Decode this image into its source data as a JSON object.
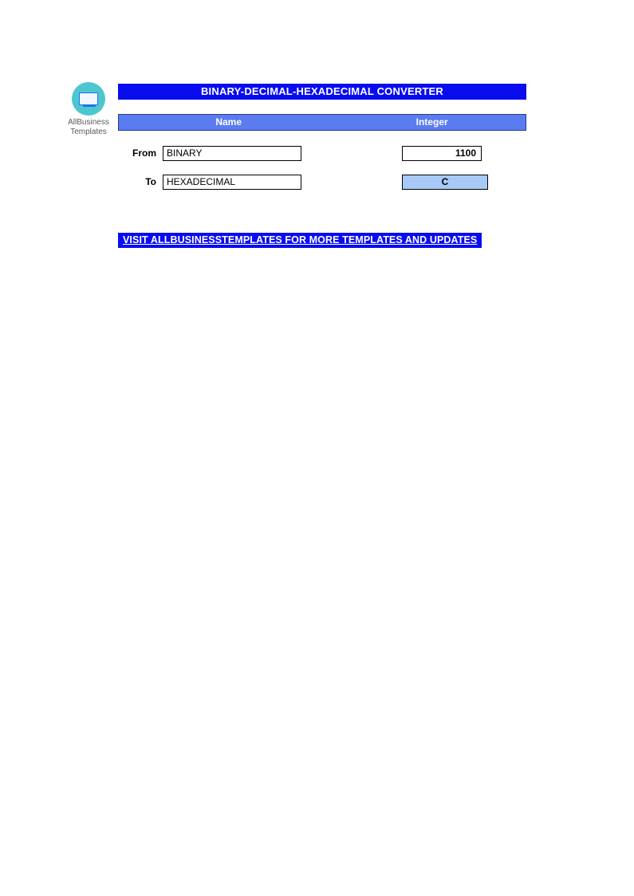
{
  "logo": {
    "line1": "AllBusiness",
    "line2": "Templates"
  },
  "title": "BINARY-DECIMAL-HEXADECIMAL CONVERTER",
  "headers": {
    "name": "Name",
    "integer": "Integer"
  },
  "rows": {
    "from": {
      "label": "From",
      "name": "BINARY",
      "value": "1100"
    },
    "to": {
      "label": "To",
      "name": "HEXADECIMAL",
      "value": "C"
    }
  },
  "footer_link": "VISIT ALLBUSINESSTEMPLATES FOR MORE TEMPLATES AND UPDATES"
}
